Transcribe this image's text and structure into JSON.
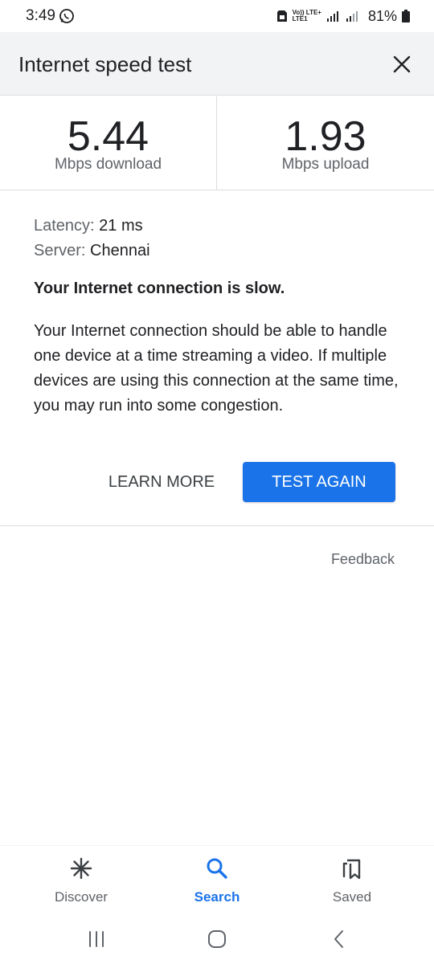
{
  "status_bar": {
    "time": "3:49",
    "network_top": "Vo)) LTE+",
    "network_bottom": "LTE1",
    "battery": "81%"
  },
  "header": {
    "title": "Internet speed test"
  },
  "results": {
    "download_value": "5.44",
    "download_unit": "Mbps download",
    "upload_value": "1.93",
    "upload_unit": "Mbps upload"
  },
  "details": {
    "latency_key": "Latency:",
    "latency_value": "21 ms",
    "server_key": "Server:",
    "server_value": "Chennai"
  },
  "verdict": "Your Internet connection is slow.",
  "description": "Your Internet connection should be able to handle one device at a time streaming a video. If multiple devices are using this connection at the same time, you may run into some congestion.",
  "actions": {
    "learn_more": "LEARN MORE",
    "test_again": "TEST AGAIN",
    "feedback": "Feedback"
  },
  "bottom_nav": {
    "items": [
      {
        "label": "Discover",
        "icon": "asterisk-icon"
      },
      {
        "label": "Search",
        "icon": "search-icon"
      },
      {
        "label": "Saved",
        "icon": "bookmarks-icon"
      }
    ],
    "active": "Search"
  },
  "colors": {
    "accent": "#1a73e8",
    "header_bg": "#f1f3f4",
    "text": "#202124",
    "secondary_text": "#5f6368"
  }
}
